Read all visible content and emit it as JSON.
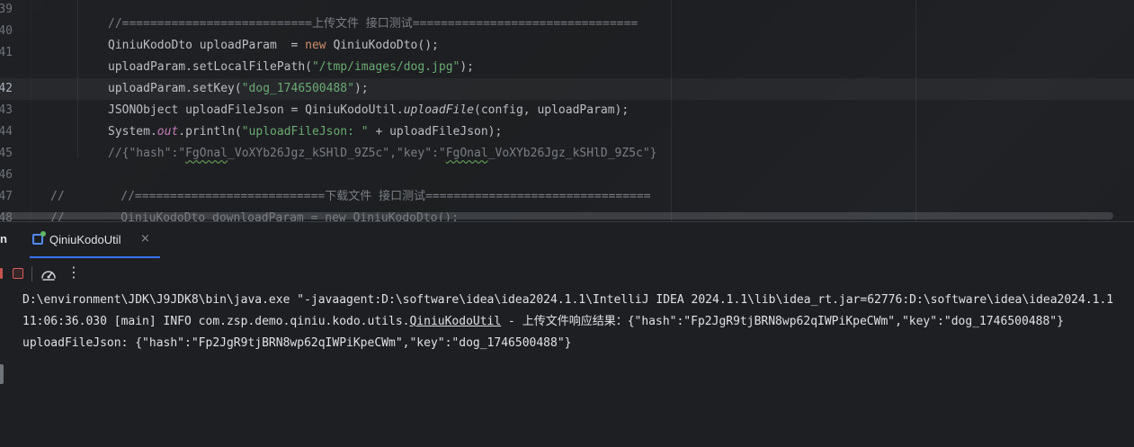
{
  "editor": {
    "line_numbers": [
      "39",
      "40",
      "41",
      "42",
      "43",
      "44",
      "45",
      "46",
      "47",
      "48"
    ],
    "current_line": "42",
    "lines": [
      {
        "segments": [
          {
            "t": "//===========================上传文件 接口测试================================",
            "c": "cmt"
          }
        ]
      },
      {
        "segments": [
          {
            "t": "QiniuKodoDto uploadParam  = "
          },
          {
            "t": "new",
            "c": "kw"
          },
          {
            "t": " QiniuKodoDto();"
          }
        ]
      },
      {
        "segments": [
          {
            "t": "uploadParam.setLocalFilePath("
          },
          {
            "t": "\"/tmp/images/dog.jpg\"",
            "c": "str"
          },
          {
            "t": ");"
          }
        ]
      },
      {
        "segments": [
          {
            "t": "uploadParam.setKey("
          },
          {
            "t": "\"dog_1746500488\"",
            "c": "str"
          },
          {
            "t": ");"
          }
        ]
      },
      {
        "segments": [
          {
            "t": "JSONObject uploadFileJson = QiniuKodoUtil."
          },
          {
            "t": "uploadFile",
            "c": "itl"
          },
          {
            "t": "(config, uploadParam);"
          }
        ]
      },
      {
        "segments": [
          {
            "t": "System."
          },
          {
            "t": "out",
            "c": "fld"
          },
          {
            "t": ".println("
          },
          {
            "t": "\"uploadFileJson: \"",
            "c": "str"
          },
          {
            "t": " + uploadFileJson);"
          }
        ]
      },
      {
        "segments": [
          {
            "t": "//{\"hash\":\"",
            "c": "cmt"
          },
          {
            "t": "FgOnal",
            "c": "cmt ul"
          },
          {
            "t": "_VoXYb26Jgz_kSHlD_9Z5c\",\"key\":\"",
            "c": "cmt"
          },
          {
            "t": "FgOnal",
            "c": "cmt ul"
          },
          {
            "t": "_VoXYb26Jgz_kSHlD_9Z5c\"}",
            "c": "cmt"
          }
        ]
      },
      {
        "segments": []
      },
      {
        "segments": [
          {
            "t": "//        //===========================下载文件 接口测试================================",
            "c": "cmt"
          }
        ]
      },
      {
        "segments": [
          {
            "t": "//        QiniuKodoDto downloadParam = new QiniuKodoDto();",
            "c": "cmt"
          }
        ]
      }
    ]
  },
  "run_panel": {
    "prefix_label": "n",
    "tab_label": "QiniuKodoUtil",
    "tab_close": "×",
    "more_icon": "⋮",
    "colors": {
      "accent": "#3574f0",
      "stop": "#db5c5c"
    }
  },
  "console": {
    "lines": [
      {
        "segments": [
          {
            "t": "D:\\environment\\JDK\\J9JDK8\\bin\\java.exe \"-javaagent:D:\\software\\idea\\idea2024.1.1\\IntelliJ IDEA 2024.1.1\\lib\\idea_rt.jar=62776:D:\\software\\idea\\idea2024.1.1"
          }
        ]
      },
      {
        "segments": [
          {
            "t": "11:06:36.030 [main] INFO com.zsp.demo.qiniu.kodo.utils."
          },
          {
            "t": "QiniuKodoUtil",
            "c": "con-link"
          },
          {
            "t": " - 上传文件响应结果：{\"hash\":\"Fp2JgR9tjBRN8wp62qIWPiKpeCWm\",\"key\":\"dog_1746500488\"}"
          }
        ]
      },
      {
        "segments": [
          {
            "t": "uploadFileJson: {\"hash\":\"Fp2JgR9tjBRN8wp62qIWPiKpeCWm\",\"key\":\"dog_1746500488\"}"
          }
        ]
      }
    ]
  }
}
